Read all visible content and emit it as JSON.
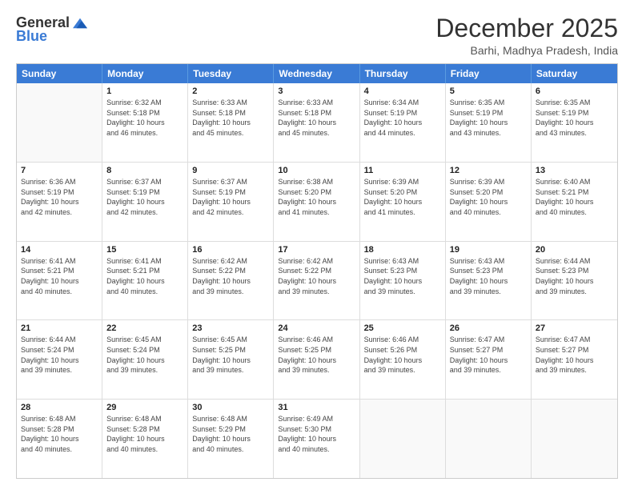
{
  "logo": {
    "general": "General",
    "blue": "Blue"
  },
  "title": "December 2025",
  "location": "Barhi, Madhya Pradesh, India",
  "header_days": [
    "Sunday",
    "Monday",
    "Tuesday",
    "Wednesday",
    "Thursday",
    "Friday",
    "Saturday"
  ],
  "weeks": [
    [
      {
        "day": "",
        "info": ""
      },
      {
        "day": "1",
        "info": "Sunrise: 6:32 AM\nSunset: 5:18 PM\nDaylight: 10 hours\nand 46 minutes."
      },
      {
        "day": "2",
        "info": "Sunrise: 6:33 AM\nSunset: 5:18 PM\nDaylight: 10 hours\nand 45 minutes."
      },
      {
        "day": "3",
        "info": "Sunrise: 6:33 AM\nSunset: 5:18 PM\nDaylight: 10 hours\nand 45 minutes."
      },
      {
        "day": "4",
        "info": "Sunrise: 6:34 AM\nSunset: 5:19 PM\nDaylight: 10 hours\nand 44 minutes."
      },
      {
        "day": "5",
        "info": "Sunrise: 6:35 AM\nSunset: 5:19 PM\nDaylight: 10 hours\nand 43 minutes."
      },
      {
        "day": "6",
        "info": "Sunrise: 6:35 AM\nSunset: 5:19 PM\nDaylight: 10 hours\nand 43 minutes."
      }
    ],
    [
      {
        "day": "7",
        "info": "Sunrise: 6:36 AM\nSunset: 5:19 PM\nDaylight: 10 hours\nand 42 minutes."
      },
      {
        "day": "8",
        "info": "Sunrise: 6:37 AM\nSunset: 5:19 PM\nDaylight: 10 hours\nand 42 minutes."
      },
      {
        "day": "9",
        "info": "Sunrise: 6:37 AM\nSunset: 5:19 PM\nDaylight: 10 hours\nand 42 minutes."
      },
      {
        "day": "10",
        "info": "Sunrise: 6:38 AM\nSunset: 5:20 PM\nDaylight: 10 hours\nand 41 minutes."
      },
      {
        "day": "11",
        "info": "Sunrise: 6:39 AM\nSunset: 5:20 PM\nDaylight: 10 hours\nand 41 minutes."
      },
      {
        "day": "12",
        "info": "Sunrise: 6:39 AM\nSunset: 5:20 PM\nDaylight: 10 hours\nand 40 minutes."
      },
      {
        "day": "13",
        "info": "Sunrise: 6:40 AM\nSunset: 5:21 PM\nDaylight: 10 hours\nand 40 minutes."
      }
    ],
    [
      {
        "day": "14",
        "info": "Sunrise: 6:41 AM\nSunset: 5:21 PM\nDaylight: 10 hours\nand 40 minutes."
      },
      {
        "day": "15",
        "info": "Sunrise: 6:41 AM\nSunset: 5:21 PM\nDaylight: 10 hours\nand 40 minutes."
      },
      {
        "day": "16",
        "info": "Sunrise: 6:42 AM\nSunset: 5:22 PM\nDaylight: 10 hours\nand 39 minutes."
      },
      {
        "day": "17",
        "info": "Sunrise: 6:42 AM\nSunset: 5:22 PM\nDaylight: 10 hours\nand 39 minutes."
      },
      {
        "day": "18",
        "info": "Sunrise: 6:43 AM\nSunset: 5:23 PM\nDaylight: 10 hours\nand 39 minutes."
      },
      {
        "day": "19",
        "info": "Sunrise: 6:43 AM\nSunset: 5:23 PM\nDaylight: 10 hours\nand 39 minutes."
      },
      {
        "day": "20",
        "info": "Sunrise: 6:44 AM\nSunset: 5:23 PM\nDaylight: 10 hours\nand 39 minutes."
      }
    ],
    [
      {
        "day": "21",
        "info": "Sunrise: 6:44 AM\nSunset: 5:24 PM\nDaylight: 10 hours\nand 39 minutes."
      },
      {
        "day": "22",
        "info": "Sunrise: 6:45 AM\nSunset: 5:24 PM\nDaylight: 10 hours\nand 39 minutes."
      },
      {
        "day": "23",
        "info": "Sunrise: 6:45 AM\nSunset: 5:25 PM\nDaylight: 10 hours\nand 39 minutes."
      },
      {
        "day": "24",
        "info": "Sunrise: 6:46 AM\nSunset: 5:25 PM\nDaylight: 10 hours\nand 39 minutes."
      },
      {
        "day": "25",
        "info": "Sunrise: 6:46 AM\nSunset: 5:26 PM\nDaylight: 10 hours\nand 39 minutes."
      },
      {
        "day": "26",
        "info": "Sunrise: 6:47 AM\nSunset: 5:27 PM\nDaylight: 10 hours\nand 39 minutes."
      },
      {
        "day": "27",
        "info": "Sunrise: 6:47 AM\nSunset: 5:27 PM\nDaylight: 10 hours\nand 39 minutes."
      }
    ],
    [
      {
        "day": "28",
        "info": "Sunrise: 6:48 AM\nSunset: 5:28 PM\nDaylight: 10 hours\nand 40 minutes."
      },
      {
        "day": "29",
        "info": "Sunrise: 6:48 AM\nSunset: 5:28 PM\nDaylight: 10 hours\nand 40 minutes."
      },
      {
        "day": "30",
        "info": "Sunrise: 6:48 AM\nSunset: 5:29 PM\nDaylight: 10 hours\nand 40 minutes."
      },
      {
        "day": "31",
        "info": "Sunrise: 6:49 AM\nSunset: 5:30 PM\nDaylight: 10 hours\nand 40 minutes."
      },
      {
        "day": "",
        "info": ""
      },
      {
        "day": "",
        "info": ""
      },
      {
        "day": "",
        "info": ""
      }
    ]
  ]
}
